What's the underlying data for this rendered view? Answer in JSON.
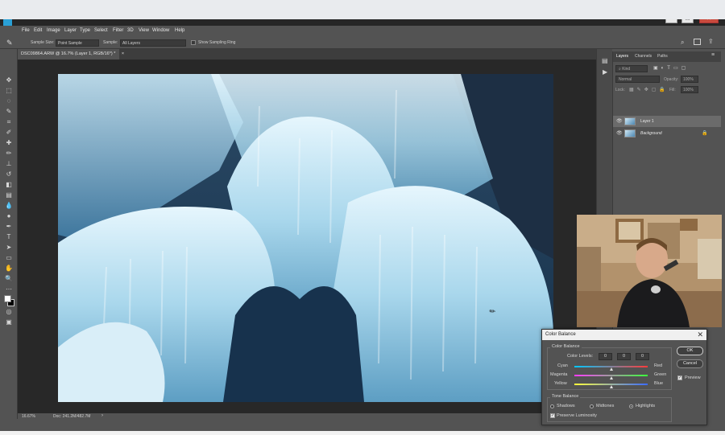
{
  "app": {
    "menu": [
      "File",
      "Edit",
      "Image",
      "Layer",
      "Type",
      "Select",
      "Filter",
      "3D",
      "View",
      "Window",
      "Help"
    ],
    "window_controls": {
      "minimize": "–",
      "maximize": "□",
      "close": "✕"
    }
  },
  "options_bar": {
    "sample_size_label": "Sample Size:",
    "sample_size_value": "Point Sample",
    "sample_label": "Sample:",
    "sample_value": "All Layers",
    "show_ring_label": "Show Sampling Ring"
  },
  "document": {
    "tab_title": "DSC09864.ARW @ 16.7% (Layer 1, RGB/16*) *",
    "tab_close": "×",
    "zoom": "16.67%",
    "doc_info": "Doc: 241.2M/482.7M"
  },
  "layers_panel": {
    "tabs": [
      "Layers",
      "Channels",
      "Paths"
    ],
    "search_placeholder": "Kind",
    "blend_mode": "Normal",
    "opacity_label": "Opacity:",
    "opacity_value": "100%",
    "lock_label": "Lock:",
    "fill_label": "Fill:",
    "fill_value": "100%",
    "layers": [
      {
        "name": "Layer 1",
        "selected": true
      },
      {
        "name": "Background",
        "selected": false
      }
    ]
  },
  "color_balance_dialog": {
    "title": "Color Balance",
    "close": "✕",
    "color_balance_group": "Color Balance",
    "color_levels_label": "Color Levels:",
    "levels": [
      "0",
      "0",
      "0"
    ],
    "sliders": [
      {
        "left": "Cyan",
        "right": "Red",
        "value": 0
      },
      {
        "left": "Magenta",
        "right": "Green",
        "value": 0
      },
      {
        "left": "Yellow",
        "right": "Blue",
        "value": 0
      }
    ],
    "tone_balance_group": "Tone Balance",
    "tones": [
      "Shadows",
      "Midtones",
      "Highlights"
    ],
    "selected_tone": "Highlights",
    "preserve_luminosity": "Preserve Luminosity",
    "ok": "OK",
    "cancel": "Cancel",
    "preview": "Preview",
    "colors": {
      "cyan_red": [
        "#00c8ff",
        "#ff3b3b"
      ],
      "magenta_green": [
        "#ff3bff",
        "#3bff3b"
      ],
      "yellow_blue": [
        "#ffff3b",
        "#3b6bff"
      ]
    }
  }
}
